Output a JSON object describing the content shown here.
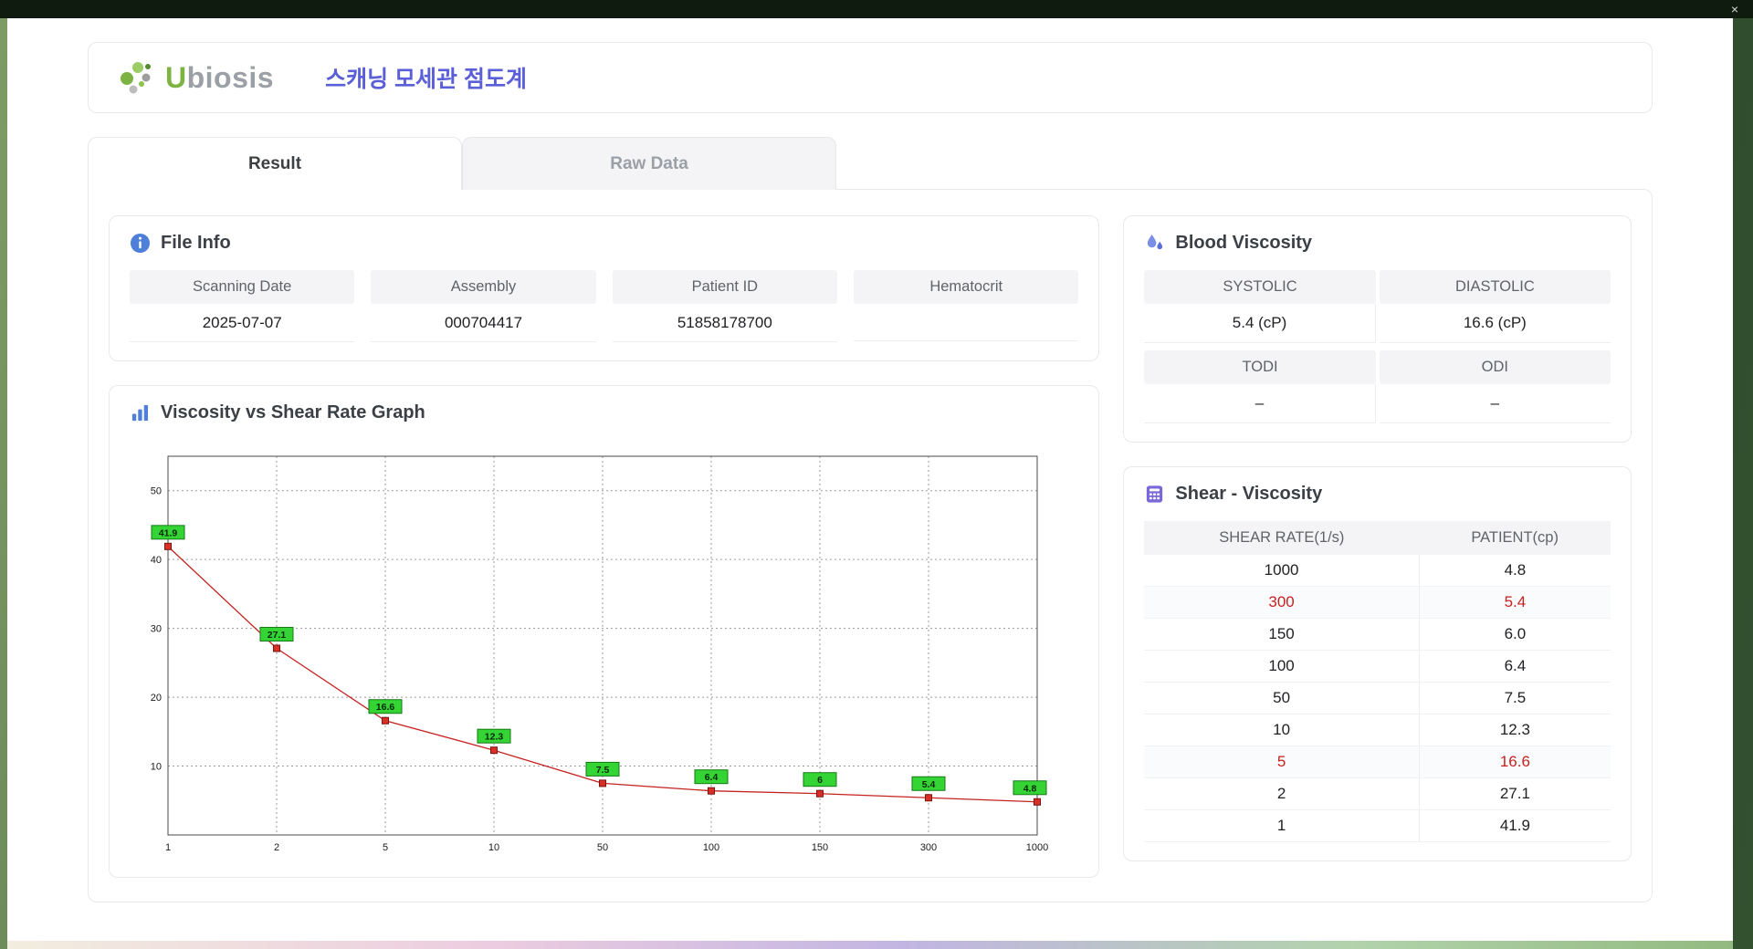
{
  "window": {
    "close_label": "×"
  },
  "header": {
    "logo_u": "U",
    "logo_rest": "biosis",
    "title": "스캐닝 모세관 점도계"
  },
  "tabs": [
    {
      "label": "Result"
    },
    {
      "label": "Raw Data"
    }
  ],
  "file_info": {
    "title": "File Info",
    "fields": [
      {
        "label": "Scanning Date",
        "value": "2025-07-07"
      },
      {
        "label": "Assembly",
        "value": "000704417"
      },
      {
        "label": "Patient ID",
        "value": "51858178700"
      },
      {
        "label": "Hematocrit",
        "value": ""
      }
    ]
  },
  "blood_viscosity": {
    "title": "Blood Viscosity",
    "cells": [
      {
        "label": "SYSTOLIC",
        "value": "5.4 (cP)"
      },
      {
        "label": "DIASTOLIC",
        "value": "16.6 (cP)"
      },
      {
        "label": "TODI",
        "value": "–"
      },
      {
        "label": "ODI",
        "value": "–"
      }
    ]
  },
  "graph": {
    "title": "Viscosity vs Shear Rate Graph"
  },
  "chart_data": {
    "type": "line",
    "title": "Viscosity vs Shear Rate Graph",
    "x": [
      1,
      2,
      5,
      10,
      50,
      100,
      150,
      300,
      1000
    ],
    "values": [
      41.9,
      27.1,
      16.6,
      12.3,
      7.5,
      6.4,
      6,
      5.4,
      4.8
    ],
    "labels": [
      "41.9",
      "27.1",
      "16.6",
      "12.3",
      "7.5",
      "6.4",
      "6",
      "5.4",
      "4.8"
    ],
    "xlabel": "",
    "ylabel": "",
    "ylim": [
      0,
      55
    ],
    "yticks": [
      10,
      20,
      30,
      40,
      50
    ],
    "x_scale": "category-even",
    "grid": true,
    "line_color": "#c5221f",
    "marker_color": "#d93025",
    "label_bg": "#35d435",
    "label_border": "#157a15"
  },
  "shear_table": {
    "title": "Shear - Viscosity",
    "columns": [
      "SHEAR RATE(1/s)",
      "PATIENT(cp)"
    ],
    "rows": [
      {
        "shear": "1000",
        "patient": "4.8",
        "highlight": false
      },
      {
        "shear": "300",
        "patient": "5.4",
        "highlight": true
      },
      {
        "shear": "150",
        "patient": "6.0",
        "highlight": false
      },
      {
        "shear": "100",
        "patient": "6.4",
        "highlight": false
      },
      {
        "shear": "50",
        "patient": "7.5",
        "highlight": false
      },
      {
        "shear": "10",
        "patient": "12.3",
        "highlight": false
      },
      {
        "shear": "5",
        "patient": "16.6",
        "highlight": true
      },
      {
        "shear": "2",
        "patient": "27.1",
        "highlight": false
      },
      {
        "shear": "1",
        "patient": "41.9",
        "highlight": false
      }
    ]
  }
}
